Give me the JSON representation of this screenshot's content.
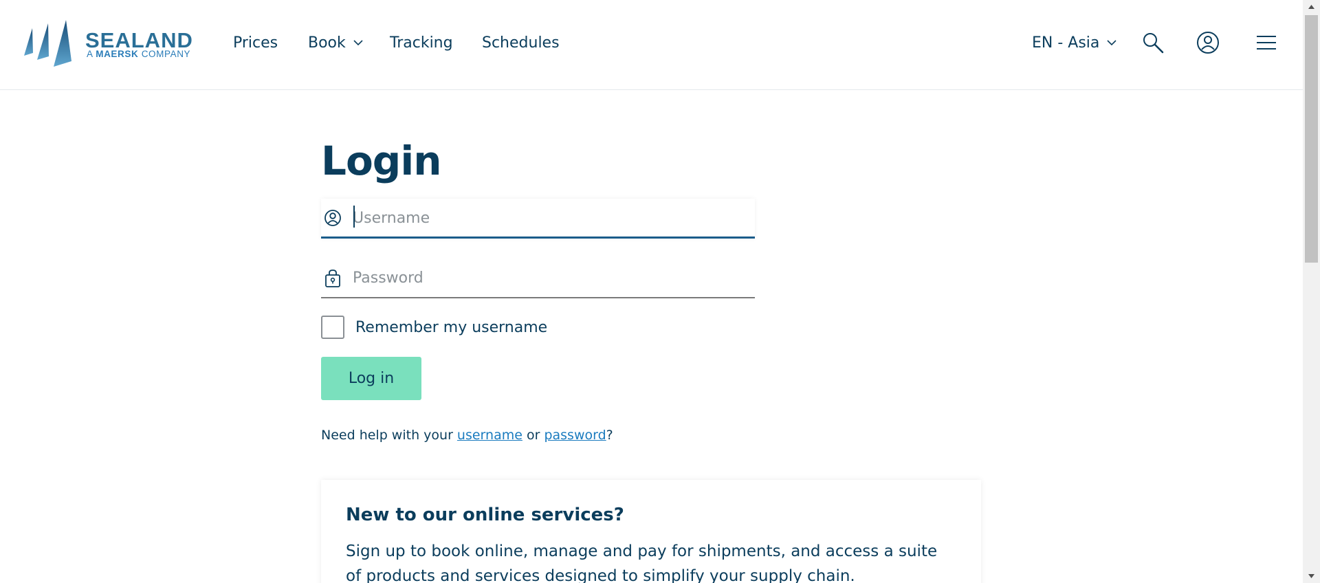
{
  "brand": {
    "name": "SEALAND",
    "tagline_prefix": "A",
    "tagline_strong": "MAERSK",
    "tagline_suffix": "COMPANY"
  },
  "nav": {
    "prices": "Prices",
    "book": "Book",
    "tracking": "Tracking",
    "schedules": "Schedules",
    "language": "EN - Asia"
  },
  "header_icons": [
    "search-icon",
    "user-icon",
    "menu-icon"
  ],
  "login": {
    "title": "Login",
    "username_placeholder": "Username",
    "username_value": "",
    "password_placeholder": "Password",
    "password_value": "",
    "remember_label": "Remember my username",
    "remember_checked": false,
    "submit_label": "Log in"
  },
  "help": {
    "prefix": "Need help with your",
    "username_link": "username",
    "middle": "or",
    "password_link": "password",
    "suffix": "?"
  },
  "signup_card": {
    "title": "New to our online services?",
    "text": "Sign up to book online, manage and pay for shipments, and access a suite of products and services designed to simplify your supply chain."
  },
  "colors": {
    "primary_text": "#0b3d5c",
    "brand_blue": "#2a6f97",
    "link": "#1a7bbf",
    "button_bg": "#7ae0bd"
  }
}
